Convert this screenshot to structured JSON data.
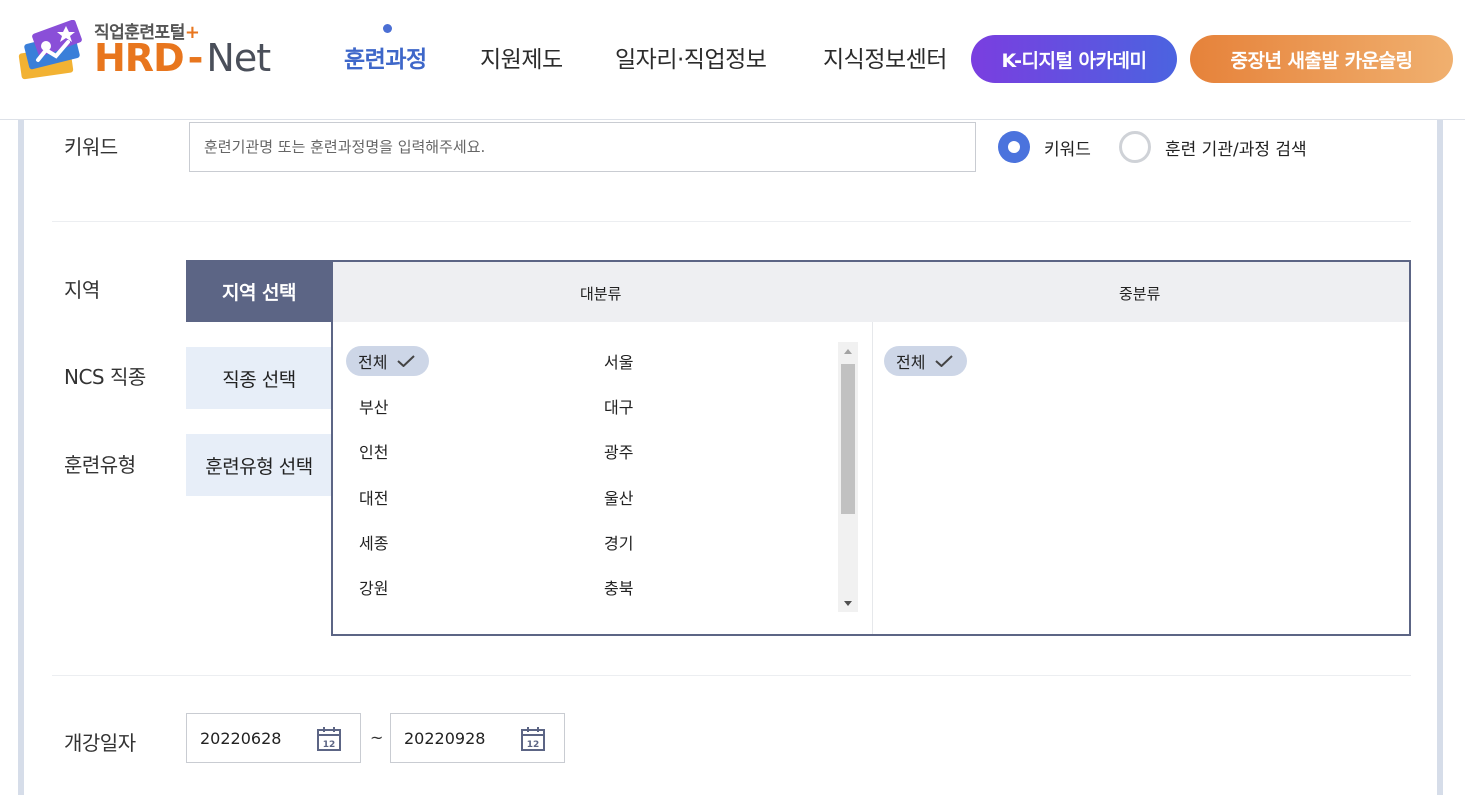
{
  "header": {
    "logo_sub": "직업훈련포털",
    "logo_plus": "+",
    "logo_hrd": "HRD",
    "logo_dash": "-",
    "logo_net": "Net",
    "nav": [
      {
        "label": "훈련과정",
        "active": true
      },
      {
        "label": "지원제도",
        "active": false
      },
      {
        "label": "일자리·직업정보",
        "active": false
      },
      {
        "label": "지식정보센터",
        "active": false
      }
    ],
    "pill_kdigital": "K-디지털 아카데미",
    "pill_counseling": "중장년 새출발 카운슬링"
  },
  "search": {
    "keyword_label": "키워드",
    "keyword_placeholder": "훈련기관명 또는 훈련과정명을 입력해주세요.",
    "keyword_value": "",
    "radio_options": [
      {
        "label": "키워드",
        "checked": true
      },
      {
        "label": "훈련 기관/과정 검색",
        "checked": false
      }
    ],
    "region_label": "지역",
    "ncs_label": "NCS 직종",
    "type_label": "훈련유형",
    "tabs": [
      "지역 선택",
      "직종 선택",
      "훈련유형 선택"
    ],
    "active_tab": "지역 선택",
    "major_header": "대분류",
    "minor_header": "중분류",
    "major_options": [
      {
        "label": "전체",
        "selected": true
      },
      {
        "label": "서울",
        "selected": false
      },
      {
        "label": "부산",
        "selected": false
      },
      {
        "label": "대구",
        "selected": false
      },
      {
        "label": "인천",
        "selected": false
      },
      {
        "label": "광주",
        "selected": false
      },
      {
        "label": "대전",
        "selected": false
      },
      {
        "label": "울산",
        "selected": false
      },
      {
        "label": "세종",
        "selected": false
      },
      {
        "label": "경기",
        "selected": false
      },
      {
        "label": "강원",
        "selected": false
      },
      {
        "label": "충북",
        "selected": false
      }
    ],
    "minor_options": [
      {
        "label": "전체",
        "selected": true
      }
    ],
    "date_label": "개강일자",
    "date_start": "20220628",
    "date_separator": "~",
    "date_end": "20220928"
  },
  "colors": {
    "brand_orange": "#e8761e",
    "nav_active": "#3e67c9",
    "tab_active": "#5c6585",
    "tab_inactive": "#e7eef8",
    "selected_chip": "#cdd6e7",
    "radio_on": "#4b73dd"
  },
  "icons": {
    "calendar": "calendar-icon",
    "check": "check-icon"
  }
}
